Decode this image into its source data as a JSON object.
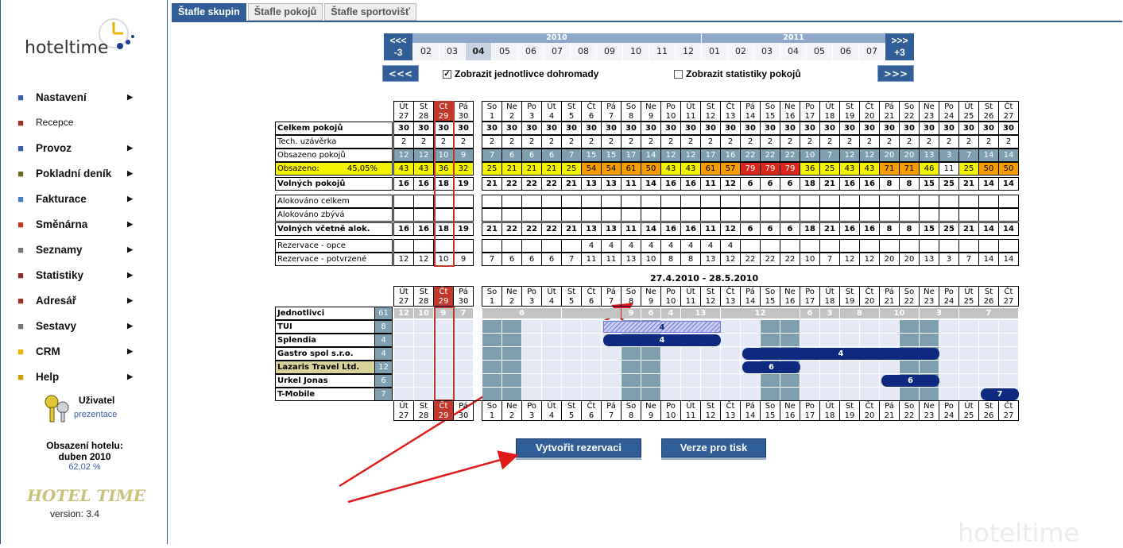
{
  "tabs": [
    "Štafle skupin",
    "Štafle pokojů",
    "Štafle sportovišť"
  ],
  "logo": {
    "text": "hoteltime"
  },
  "menu": [
    {
      "label": "Nastavení",
      "icon": "settings-icon",
      "arrow": true
    },
    {
      "label": "Recepce",
      "icon": "reception-icon",
      "arrow": false
    },
    {
      "label": "Provoz",
      "icon": "gear-icon",
      "arrow": true
    },
    {
      "label": "Pokladní deník",
      "icon": "cashbook-icon",
      "arrow": true
    },
    {
      "label": "Fakturace",
      "icon": "invoice-icon",
      "arrow": true
    },
    {
      "label": "Směnárna",
      "icon": "flag-icon",
      "arrow": true
    },
    {
      "label": "Seznamy",
      "icon": "list-icon",
      "arrow": true
    },
    {
      "label": "Statistiky",
      "icon": "chart-icon",
      "arrow": true
    },
    {
      "label": "Adresář",
      "icon": "book-icon",
      "arrow": true
    },
    {
      "label": "Sestavy",
      "icon": "printer-icon",
      "arrow": true
    },
    {
      "label": "CRM",
      "icon": "crm-icon",
      "arrow": true
    },
    {
      "label": "Help",
      "icon": "help-icon",
      "arrow": true
    }
  ],
  "user": {
    "label": "Uživatel",
    "name": "prezentace"
  },
  "occupancy": {
    "title": "Obsazení hotelu:",
    "month": "duben 2010",
    "value": "62,02 %"
  },
  "version": "version: 3.4",
  "nav": {
    "prev3_top": "<<<",
    "prev3_bottom": "-3",
    "next3_top": ">>>",
    "next3_bottom": "+3",
    "year1": "2010",
    "year2": "2011",
    "months": [
      "02",
      "03",
      "04",
      "05",
      "06",
      "07",
      "08",
      "09",
      "10",
      "11",
      "12",
      "01",
      "02",
      "03",
      "04",
      "05",
      "06",
      "07"
    ],
    "selected_index": 2,
    "prev": "<<<",
    "next": ">>>"
  },
  "options": {
    "show_individuals": "Zobrazit jednotlivce dohromady",
    "show_individuals_checked": "✓",
    "show_room_stats": "Zobrazit statistiky pokojů"
  },
  "days": [
    [
      "Út",
      "27"
    ],
    [
      "St",
      "28"
    ],
    [
      "Čt",
      "29"
    ],
    [
      "Pá",
      "30"
    ],
    [
      "So",
      "1"
    ],
    [
      "Ne",
      "2"
    ],
    [
      "Po",
      "3"
    ],
    [
      "Út",
      "4"
    ],
    [
      "St",
      "5"
    ],
    [
      "Čt",
      "6"
    ],
    [
      "Pá",
      "7"
    ],
    [
      "So",
      "8"
    ],
    [
      "Ne",
      "9"
    ],
    [
      "Po",
      "10"
    ],
    [
      "Út",
      "11"
    ],
    [
      "St",
      "12"
    ],
    [
      "Čt",
      "13"
    ],
    [
      "Pá",
      "14"
    ],
    [
      "So",
      "15"
    ],
    [
      "Ne",
      "16"
    ],
    [
      "Po",
      "17"
    ],
    [
      "Út",
      "18"
    ],
    [
      "St",
      "19"
    ],
    [
      "Čt",
      "20"
    ],
    [
      "Pá",
      "21"
    ],
    [
      "So",
      "22"
    ],
    [
      "Ne",
      "23"
    ],
    [
      "Po",
      "24"
    ],
    [
      "Út",
      "25"
    ],
    [
      "St",
      "26"
    ],
    [
      "Čt",
      "27"
    ]
  ],
  "stats": {
    "labels": [
      "Celkem pokojů",
      "Tech. uzávěrka",
      "Obsazeno pokojů",
      "Obsazeno:",
      "Volných pokojů",
      "Alokováno celkem",
      "Alokováno zbývá",
      "Volných včetně alok.",
      "Rezervace - opce",
      "Rezervace - potvrzené"
    ],
    "occupied_pct": "45,05%",
    "total": [
      "30",
      "30",
      "30",
      "30",
      "30",
      "30",
      "30",
      "30",
      "30",
      "30",
      "30",
      "30",
      "30",
      "30",
      "30",
      "30",
      "30",
      "30",
      "30",
      "30",
      "30",
      "30",
      "30",
      "30",
      "30",
      "30",
      "30",
      "30",
      "30",
      "30",
      "30"
    ],
    "tech": [
      "2",
      "2",
      "2",
      "2",
      "2",
      "2",
      "2",
      "2",
      "2",
      "2",
      "2",
      "2",
      "2",
      "2",
      "2",
      "2",
      "2",
      "2",
      "2",
      "2",
      "2",
      "2",
      "2",
      "2",
      "2",
      "2",
      "2",
      "2",
      "2",
      "2",
      "2"
    ],
    "occ_rooms": [
      "12",
      "12",
      "10",
      "9",
      "7",
      "6",
      "6",
      "6",
      "7",
      "15",
      "15",
      "17",
      "14",
      "12",
      "12",
      "17",
      "16",
      "22",
      "22",
      "22",
      "10",
      "7",
      "12",
      "12",
      "20",
      "20",
      "13",
      "3",
      "7",
      "14",
      "14"
    ],
    "occ_pct": [
      "43",
      "43",
      "36",
      "32",
      "25",
      "21",
      "21",
      "21",
      "25",
      "54",
      "54",
      "61",
      "50",
      "43",
      "43",
      "61",
      "57",
      "79",
      "79",
      "79",
      "36",
      "25",
      "43",
      "43",
      "71",
      "71",
      "46",
      "11",
      "25",
      "50",
      "50"
    ],
    "free": [
      "16",
      "16",
      "18",
      "19",
      "21",
      "22",
      "22",
      "22",
      "21",
      "13",
      "13",
      "11",
      "14",
      "16",
      "16",
      "11",
      "12",
      "6",
      "6",
      "6",
      "18",
      "21",
      "16",
      "16",
      "8",
      "8",
      "15",
      "25",
      "21",
      "14",
      "14"
    ],
    "free_alloc": [
      "16",
      "16",
      "18",
      "19",
      "21",
      "22",
      "22",
      "22",
      "21",
      "13",
      "13",
      "11",
      "14",
      "16",
      "16",
      "11",
      "12",
      "6",
      "6",
      "6",
      "18",
      "21",
      "16",
      "16",
      "8",
      "8",
      "15",
      "25",
      "21",
      "14",
      "14"
    ],
    "opce": [
      "",
      "",
      "",
      "",
      "",
      "",
      "",
      "",
      "",
      "4",
      "4",
      "4",
      "4",
      "4",
      "4",
      "4",
      "4",
      "",
      "",
      "",
      "",
      "",
      "",
      "",
      "",
      "",
      "",
      "",
      "",
      "",
      ""
    ],
    "confirmed": [
      "12",
      "12",
      "10",
      "9",
      "7",
      "6",
      "6",
      "6",
      "7",
      "11",
      "11",
      "13",
      "10",
      "8",
      "8",
      "13",
      "12",
      "22",
      "22",
      "22",
      "10",
      "7",
      "12",
      "12",
      "20",
      "20",
      "13",
      "3",
      "7",
      "14",
      "14"
    ]
  },
  "period": "27.4.2010 - 28.5.2010",
  "groups": [
    {
      "name": "Jednotlivci",
      "count": "61"
    },
    {
      "name": "TUI",
      "count": "8"
    },
    {
      "name": "Splendia",
      "count": "4"
    },
    {
      "name": "Gastro spol s.r.o.",
      "count": "4"
    },
    {
      "name": "Lazaris Travel Ltd.",
      "count": "12"
    },
    {
      "name": "Urkel Jonas",
      "count": "6"
    },
    {
      "name": "T-Mobile",
      "count": "7"
    }
  ],
  "indiv_segments": [
    {
      "from": 1,
      "to": 1,
      "label": "12"
    },
    {
      "from": 2,
      "to": 2,
      "label": "10"
    },
    {
      "from": 3,
      "to": 3,
      "label": "9"
    },
    {
      "from": 4,
      "to": 4,
      "label": "7"
    },
    {
      "from": 5,
      "to": 8,
      "label": "6"
    },
    {
      "from": 9,
      "to": 11,
      "label": ""
    },
    {
      "from": 12,
      "to": 12,
      "label": "9"
    },
    {
      "from": 13,
      "to": 13,
      "label": "6"
    },
    {
      "from": 14,
      "to": 14,
      "label": "4"
    },
    {
      "from": 15,
      "to": 16,
      "label": "13"
    },
    {
      "from": 17,
      "to": 20,
      "label": "12"
    },
    {
      "from": 21,
      "to": 21,
      "label": "6"
    },
    {
      "from": 22,
      "to": 22,
      "label": "3"
    },
    {
      "from": 23,
      "to": 24,
      "label": "8"
    },
    {
      "from": 25,
      "to": 26,
      "label": "10"
    },
    {
      "from": 27,
      "to": 28,
      "label": "3"
    },
    {
      "from": 29,
      "to": 31,
      "label": "7"
    }
  ],
  "bars": [
    {
      "row": 1,
      "from": 11,
      "to": 16,
      "label": "4",
      "opce": true
    },
    {
      "row": 2,
      "from": 11,
      "to": 16,
      "label": "4"
    },
    {
      "row": 3,
      "from": 18,
      "to": 27,
      "label": "4"
    },
    {
      "row": 4,
      "from": 18,
      "to": 20,
      "label": "6"
    },
    {
      "row": 5,
      "from": 25,
      "to": 27,
      "label": "6"
    },
    {
      "row": 6,
      "from": 30,
      "to": 31,
      "label": "7"
    }
  ],
  "buttons": {
    "create": "Vytvořit rezervaci",
    "print": "Verze pro tisk"
  },
  "watermark": "hoteltime",
  "hotel_logo": "HOTEL TIME",
  "colors": {
    "blue": "#2f5f96",
    "today": "#c0392b",
    "yellow": "#f3f300",
    "orange": "#f59c00",
    "red": "#d8281e",
    "weekend": "#7d9fb0",
    "arrow": "#e01b1b"
  }
}
